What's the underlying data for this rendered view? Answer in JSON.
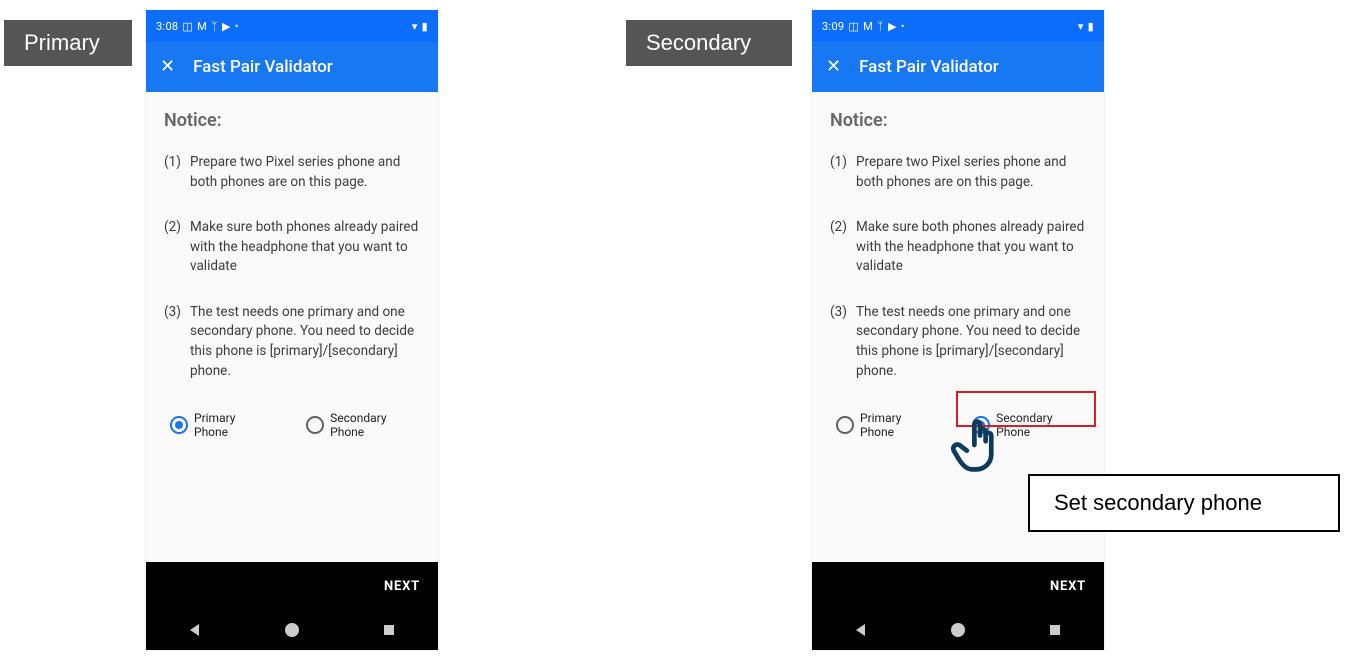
{
  "labels": {
    "primary_tag": "Primary",
    "secondary_tag": "Secondary",
    "callout": "Set secondary phone"
  },
  "left": {
    "status_time": "3:08",
    "app_title": "Fast Pair Validator",
    "notice_heading": "Notice:",
    "steps": [
      {
        "num": "(1)",
        "text": "Prepare two Pixel series phone and both phones are on this page."
      },
      {
        "num": "(2)",
        "text": "Make sure both phones already paired with the headphone that you want to validate"
      },
      {
        "num": "(3)",
        "text": "The test needs one primary and one secondary phone. You need to decide this phone is [primary]/[secondary] phone."
      }
    ],
    "radio_primary": "Primary Phone",
    "radio_secondary": "Secondary Phone",
    "selected": "primary",
    "next_label": "NEXT"
  },
  "right": {
    "status_time": "3:09",
    "app_title": "Fast Pair Validator",
    "notice_heading": "Notice:",
    "steps": [
      {
        "num": "(1)",
        "text": "Prepare two Pixel series phone and both phones are on this page."
      },
      {
        "num": "(2)",
        "text": "Make sure both phones already paired with the headphone that you want to validate"
      },
      {
        "num": "(3)",
        "text": "The test needs one primary and one secondary phone. You need to decide this phone is [primary]/[secondary] phone."
      }
    ],
    "radio_primary": "Primary Phone",
    "radio_secondary": "Secondary Phone",
    "selected": "secondary",
    "next_label": "NEXT"
  }
}
